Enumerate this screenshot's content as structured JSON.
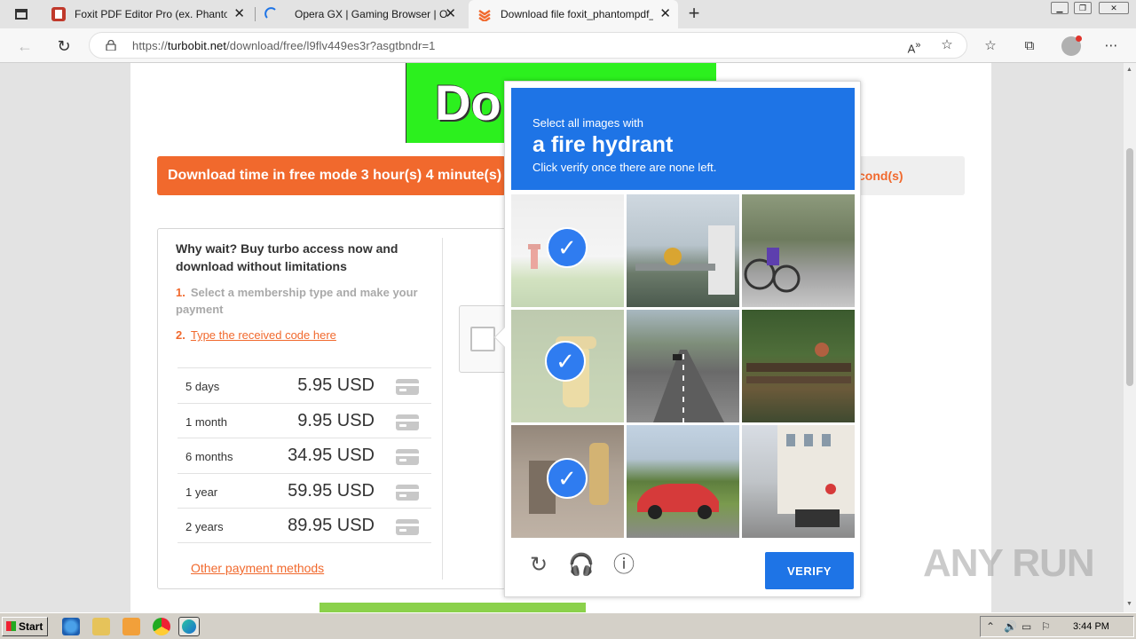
{
  "browser": {
    "tabs": [
      {
        "title": "Foxit PDF Editor Pro (ex. Phantom",
        "active": false
      },
      {
        "title": "Opera GX | Gaming Browser | Op",
        "active": false
      },
      {
        "title": "Download file foxit_phantompdf_",
        "active": true
      }
    ],
    "url_prefix": "https://",
    "url_domain": "turbobit.net",
    "url_path": "/download/free/l9flv449es3r?asgtbndr=1"
  },
  "page": {
    "banner_text": "Do",
    "wait_text": "Download time in free mode 3 hour(s) 4 minute(s)",
    "wait_text_right": "cond(s)",
    "panel_title": "Why wait? Buy turbo access now and download without limitations",
    "step1_num": "1.",
    "step1_text": "Select a membership type and make your payment",
    "step2_num": "2.",
    "step2_link": "Type the received code here",
    "prices": [
      {
        "duration": "5 days",
        "price": "5.95 USD"
      },
      {
        "duration": "1 month",
        "price": "9.95 USD"
      },
      {
        "duration": "6 months",
        "price": "34.95 USD"
      },
      {
        "duration": "1 year",
        "price": "59.95 USD"
      },
      {
        "duration": "2 years",
        "price": "89.95 USD"
      }
    ],
    "other_payment": "Other payment methods"
  },
  "captcha": {
    "prompt_sub": "Select all images with",
    "target": "a fire hydrant",
    "hint": "Click verify once there are none left.",
    "verify_label": "VERIFY",
    "tiles_selected": [
      true,
      false,
      false,
      true,
      false,
      false,
      true,
      false,
      false
    ]
  },
  "watermark": "ANY RUN",
  "taskbar": {
    "start_label": "Start",
    "clock": "3:44 PM"
  }
}
